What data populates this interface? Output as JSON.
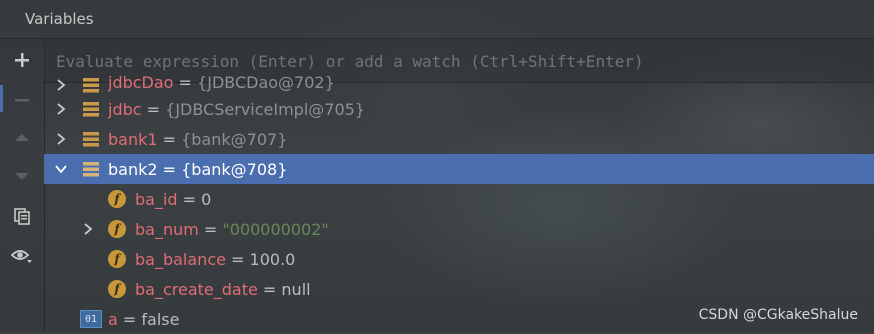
{
  "panel": {
    "title": "Variables"
  },
  "input": {
    "placeholder": "Evaluate expression (Enter) or add a watch (Ctrl+Shift+Enter)"
  },
  "tree": [
    {
      "name": "jdbcDao",
      "eq": " = ",
      "value": "{JDBCDao@702}",
      "arrow": "collapsed",
      "icon": "object-icon"
    },
    {
      "name": "jdbc",
      "eq": " = ",
      "value": "{JDBCServiceImpl@705}",
      "arrow": "collapsed",
      "icon": "object-icon"
    },
    {
      "name": "bank1",
      "eq": " = ",
      "value": "{bank@707}",
      "arrow": "collapsed",
      "icon": "object-icon"
    },
    {
      "name": "bank2",
      "eq": " = ",
      "value": "{bank@708}",
      "arrow": "expanded",
      "icon": "object-icon",
      "selected": true
    },
    {
      "name": "ba_id",
      "eq": " = ",
      "value": "0",
      "arrow": "none",
      "icon": "field-icon"
    },
    {
      "name": "ba_num",
      "eq": " = ",
      "value": "\"000000002\"",
      "arrow": "collapsed",
      "icon": "field-icon"
    },
    {
      "name": "ba_balance",
      "eq": " = ",
      "value": "100.0",
      "arrow": "none",
      "icon": "field-icon"
    },
    {
      "name": "ba_create_date",
      "eq": " = ",
      "value": "null",
      "arrow": "none",
      "icon": "field-icon"
    },
    {
      "name": "a",
      "eq": " = ",
      "value": "false",
      "arrow": "none",
      "icon": "primitive-icon"
    }
  ],
  "icons": {
    "field_label": "f",
    "primitive_label": "01"
  },
  "watermark": "CSDN @CGkakeShalue",
  "colors": {
    "selection": "#4b6eaf",
    "name": "#e06c75",
    "string": "#6a8759",
    "field_icon": "#c9973b"
  }
}
